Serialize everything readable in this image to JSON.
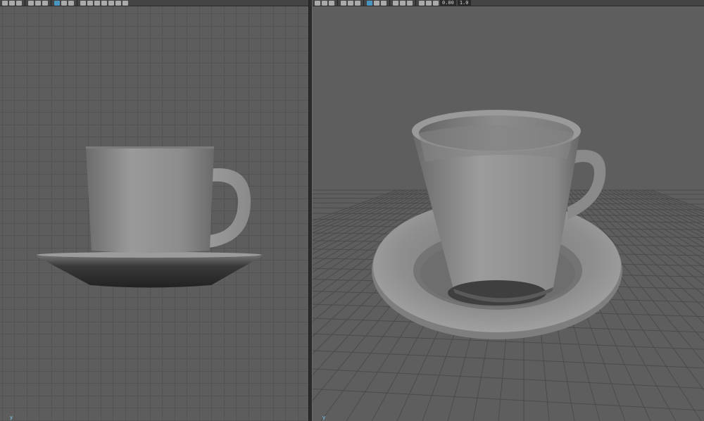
{
  "window": {
    "panes": [
      "front-view",
      "perspective-view"
    ]
  },
  "toolbar": {
    "icons": [
      "camera-icon",
      "bookmark-icon",
      "film-icon",
      "lock-icon",
      "grid-icon",
      "wireframe-icon",
      "smooth-shade-icon",
      "textured-icon",
      "lights-icon",
      "shadows-icon",
      "xray-icon",
      "isolate-icon"
    ],
    "field_value": "0.00",
    "field_value2": "1.0"
  },
  "left_view": {
    "axis_label": "y"
  },
  "right_view": {
    "axis_label": "y"
  },
  "colors": {
    "viewport_bg": "#5d5d5d",
    "grid_line": "#4a4a4a",
    "grid_axis": "#2e2e2e",
    "accent": "#4aa3d8"
  }
}
